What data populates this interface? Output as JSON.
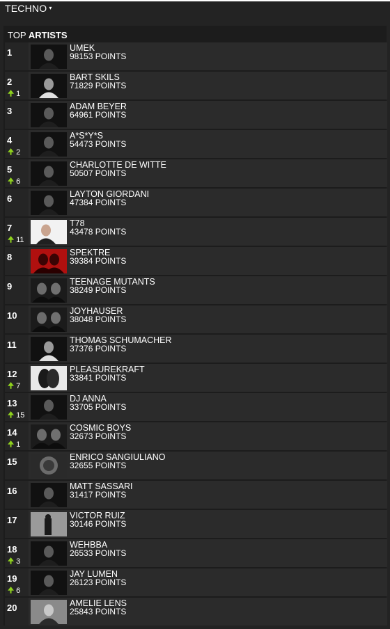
{
  "genre": {
    "label": "TECHNO",
    "caret": "▾"
  },
  "section": {
    "title_prefix": "TOP ",
    "title_bold": "ARTISTS"
  },
  "arrow_glyph": "🠉",
  "artists": [
    {
      "rank": "1",
      "name": "UMEK",
      "points": "98153 POINTS",
      "change": "",
      "thumb": "dark-portrait"
    },
    {
      "rank": "2",
      "name": "BART SKILS",
      "points": "71829 POINTS",
      "change": "1",
      "thumb": "bw-portrait"
    },
    {
      "rank": "3",
      "name": "ADAM BEYER",
      "points": "64961 POINTS",
      "change": "",
      "thumb": "dark-portrait"
    },
    {
      "rank": "4",
      "name": "A*S*Y*S",
      "points": "54473 POINTS",
      "change": "2",
      "thumb": "dark-portrait"
    },
    {
      "rank": "5",
      "name": "CHARLOTTE DE WITTE",
      "points": "50507 POINTS",
      "change": "6",
      "thumb": "dark-portrait"
    },
    {
      "rank": "6",
      "name": "LAYTON GIORDANI",
      "points": "47384 POINTS",
      "change": "",
      "thumb": "dark-portrait"
    },
    {
      "rank": "7",
      "name": "T78",
      "points": "43478 POINTS",
      "change": "11",
      "thumb": "light-portrait"
    },
    {
      "rank": "8",
      "name": "SPEKTRE",
      "points": "39384 POINTS",
      "change": "",
      "thumb": "red-duo"
    },
    {
      "rank": "9",
      "name": "TEENAGE MUTANTS",
      "points": "38249 POINTS",
      "change": "",
      "thumb": "duo"
    },
    {
      "rank": "10",
      "name": "JOYHAUSER",
      "points": "38048 POINTS",
      "change": "",
      "thumb": "duo"
    },
    {
      "rank": "11",
      "name": "THOMAS SCHUMACHER",
      "points": "37376 POINTS",
      "change": "",
      "thumb": "bw-portrait"
    },
    {
      "rank": "12",
      "name": "PLEASUREKRAFT",
      "points": "33841 POINTS",
      "change": "7",
      "thumb": "light-masks"
    },
    {
      "rank": "13",
      "name": "DJ ANNA",
      "points": "33705 POINTS",
      "change": "15",
      "thumb": "dark-portrait"
    },
    {
      "rank": "14",
      "name": "COSMIC BOYS",
      "points": "32673 POINTS",
      "change": "1",
      "thumb": "duo"
    },
    {
      "rank": "15",
      "name": "ENRICO SANGIULIANO",
      "points": "32655 POINTS",
      "change": "",
      "thumb": "sphere"
    },
    {
      "rank": "16",
      "name": "MATT SASSARI",
      "points": "31417 POINTS",
      "change": "",
      "thumb": "dark-portrait"
    },
    {
      "rank": "17",
      "name": "VICTOR RUIZ",
      "points": "30146 POINTS",
      "change": "",
      "thumb": "grey-figure"
    },
    {
      "rank": "18",
      "name": "WEHBBA",
      "points": "26533 POINTS",
      "change": "3",
      "thumb": "dark-portrait"
    },
    {
      "rank": "19",
      "name": "JAY LUMEN",
      "points": "26123 POINTS",
      "change": "6",
      "thumb": "dark-portrait"
    },
    {
      "rank": "20",
      "name": "AMELIE LENS",
      "points": "25843 POINTS",
      "change": "",
      "thumb": "grey-portrait"
    }
  ],
  "colors": {
    "arrow_up": "#8fd11e",
    "row_bg": "#2b2b2b",
    "page_bg": "#232323"
  }
}
